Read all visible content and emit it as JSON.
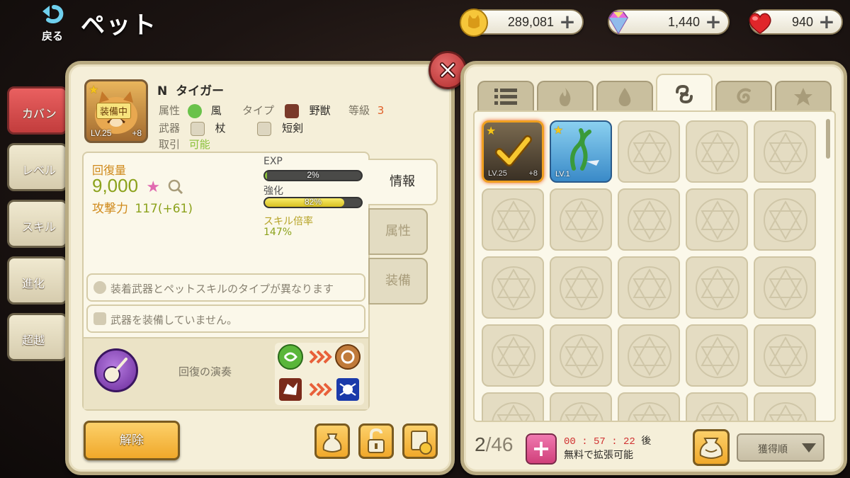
{
  "header": {
    "back_label": "戻る",
    "title": "ペット"
  },
  "currencies": [
    {
      "name": "gold-cat-coin",
      "amount": "289,081"
    },
    {
      "name": "gem",
      "amount": "1,440"
    },
    {
      "name": "heart",
      "amount": "940"
    }
  ],
  "side_tabs": [
    {
      "label": "カバン",
      "active": true
    },
    {
      "label": "レベル"
    },
    {
      "label": "スキル"
    },
    {
      "label": "進化"
    },
    {
      "label": "超越"
    }
  ],
  "pet": {
    "rank": "N",
    "name": "タイガー",
    "equip_badge": "装備中",
    "level_text": "LV.25",
    "plus_text": "+8",
    "attribute_label": "属性",
    "attribute_value": "風",
    "type_label": "タイプ",
    "type_value": "野獣",
    "grade_label": "等級",
    "grade_value": "3",
    "weapon_label": "武器",
    "weapon_1": "杖",
    "weapon_2": "短剣",
    "trade_label": "取引",
    "trade_value": "可能"
  },
  "stats": {
    "recovery_label": "回復量",
    "recovery_value": "9,000",
    "attack_label": "攻撃力",
    "attack_value": "117(+61)",
    "exp_label": "EXP",
    "exp_percent": 2,
    "exp_text": "2%",
    "enhance_label": "強化",
    "enhance_percent": 82,
    "enhance_text": "82%",
    "skill_rate_label": "スキル倍率",
    "skill_rate_value": "147%"
  },
  "info_tabs": [
    {
      "label": "情報",
      "active": true
    },
    {
      "label": "属性"
    },
    {
      "label": "装備"
    }
  ],
  "notes": [
    "装着武器とペットスキルのタイプが異なります",
    "武器を装備していません。"
  ],
  "skill": {
    "name": "回復の演奏"
  },
  "buttons": {
    "release": "解除"
  },
  "inventory": {
    "tabs": [
      "list-icon",
      "fire-icon",
      "water-icon",
      "wind-icon",
      "spiral-icon",
      "star-icon"
    ],
    "active_tab": 3,
    "item_1": {
      "level": "LV.25",
      "plus": "+8"
    },
    "item_2": {
      "level": "LV.1"
    },
    "count_current": "2",
    "count_total": "/46",
    "timer": "00 : 57 : 22",
    "timer_suffix": "後",
    "free_expand": "無料で拡張可能",
    "sort_label": "獲得順"
  },
  "colors": {
    "active_tab": "#c23d3d",
    "accent_green": "#8ca21c",
    "accent_orange": "#d08a1c",
    "button_gold": "#f0a82a"
  }
}
